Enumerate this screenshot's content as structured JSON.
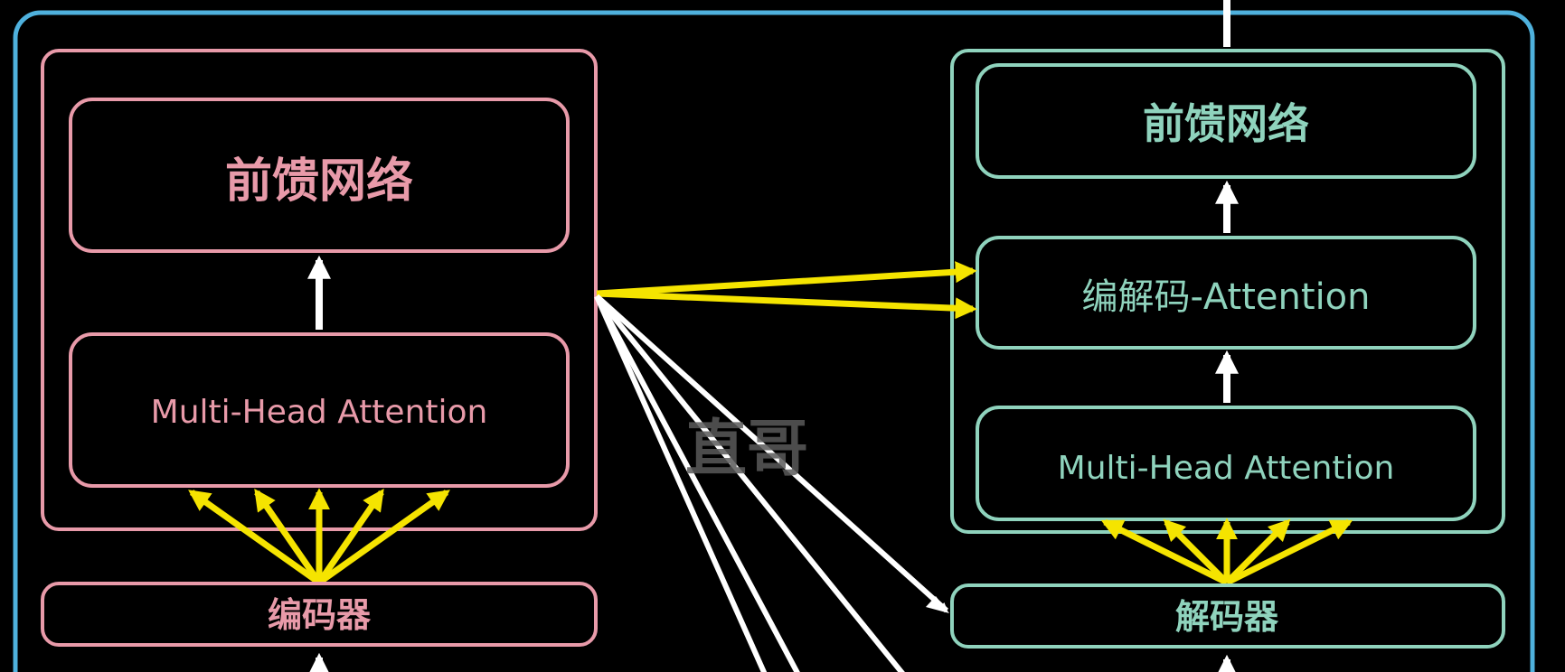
{
  "colors": {
    "background": "#000000",
    "frame": "#4fb1dd",
    "encoder": "#e89aa9",
    "decoder": "#8fd3bd",
    "arrow_yellow": "#f5e400",
    "arrow_white": "#ffffff",
    "watermark": "#5a5a5a"
  },
  "encoder": {
    "ffn_label": "前馈网络",
    "attention_label": "Multi-Head Attention",
    "input_label": "编码器"
  },
  "decoder": {
    "ffn_label": "前馈网络",
    "enc_dec_attention_label": "编解码-Attention",
    "attention_label": "Multi-Head Attention",
    "input_label": "解码器"
  },
  "watermark": {
    "text": "直哥"
  }
}
